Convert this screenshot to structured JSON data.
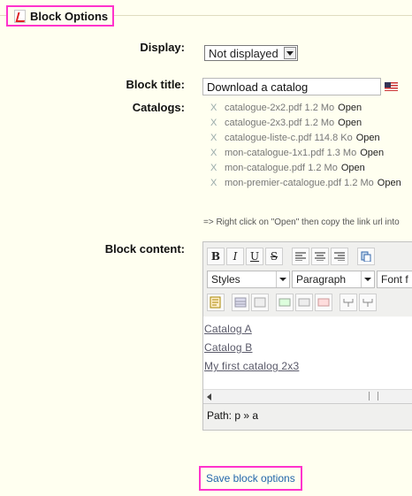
{
  "header": {
    "title": "Block Options"
  },
  "form": {
    "display_label": "Display:",
    "display_value": "Not displayed",
    "title_label": "Block title:",
    "title_value": "Download a catalog",
    "catalogs_label": "Catalogs:",
    "catalogs": [
      {
        "name": "catalogue-2x2.pdf",
        "size": "1.2 Mo",
        "open": "Open"
      },
      {
        "name": "catalogue-2x3.pdf",
        "size": "1.2 Mo",
        "open": "Open"
      },
      {
        "name": "catalogue-liste-c.pdf",
        "size": "114.8 Ko",
        "open": "Open"
      },
      {
        "name": "mon-catalogue-1x1.pdf",
        "size": "1.3 Mo",
        "open": "Open"
      },
      {
        "name": "mon-catalogue.pdf",
        "size": "1.2 Mo",
        "open": "Open"
      },
      {
        "name": "mon-premier-catalogue.pdf",
        "size": "1.2 Mo",
        "open": "Open"
      }
    ],
    "hint": "=> Right click on \"Open\" then copy the link url into",
    "content_label": "Block content:"
  },
  "editor": {
    "toolbar1": {
      "bold": "B",
      "italic": "I",
      "underline": "U",
      "strike": "S"
    },
    "styles": "Styles",
    "format": "Paragraph",
    "font": "Font f",
    "links": [
      "Catalog A",
      "Catalog B",
      "My first catalog 2x3"
    ],
    "path": "Path: p » a"
  },
  "save_label": "Save block options"
}
